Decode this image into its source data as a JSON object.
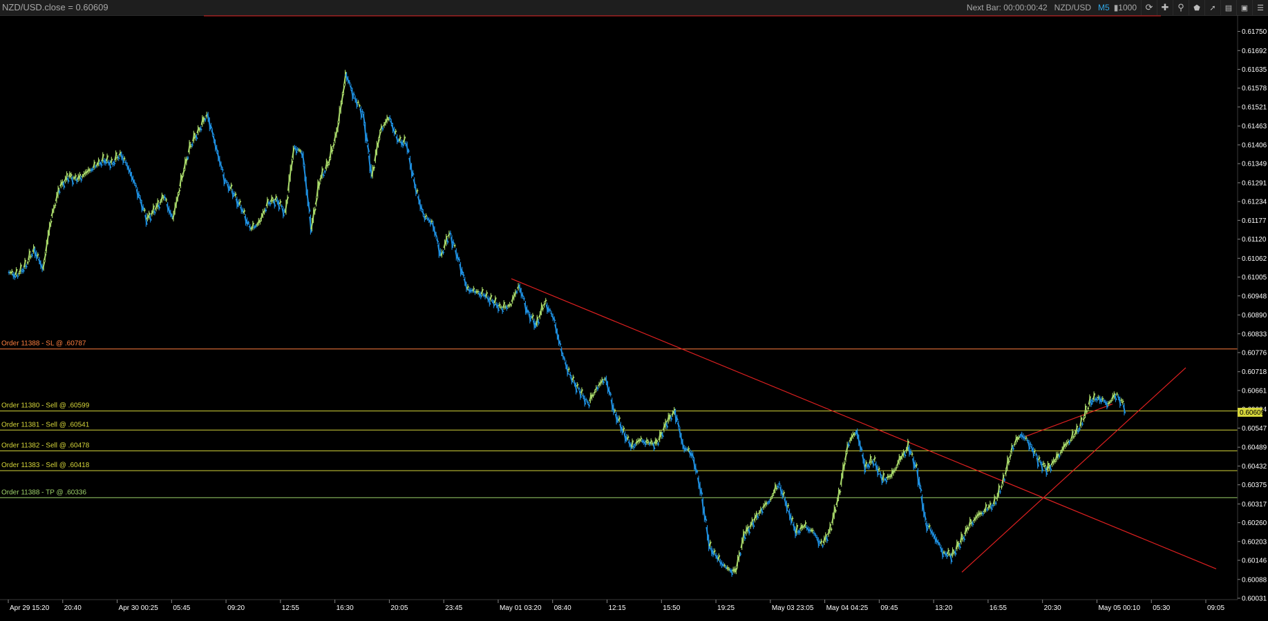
{
  "window": {
    "title": "NZD/USD.close = 0.60609",
    "next_bar_label": "Next Bar: 00:00:00:42",
    "symbol": "NZD/USD",
    "timeframe": "M5",
    "bar_count": "1000"
  },
  "toolbar_icons": [
    "refresh-icon",
    "crosshair-icon",
    "zoom-icon",
    "shape-icon",
    "line-tool-icon",
    "lock-icon",
    "save-icon",
    "menu-icon"
  ],
  "colors": {
    "background": "#000000",
    "up_candle": "#a8d86a",
    "down_candle": "#1e8fe0",
    "trendline": "#e02020",
    "sell_order": "#d6d63a",
    "stop_loss": "#ff7f3f",
    "take_profit": "#9ed36a"
  },
  "chart_data": {
    "type": "line",
    "symbol": "NZD/USD",
    "timeframe": "M5",
    "ylim": [
      0.60031,
      0.6177
    ],
    "y_ticks": [
      "0.61750",
      "0.61692",
      "0.61635",
      "0.61578",
      "0.61521",
      "0.61463",
      "0.61406",
      "0.61349",
      "0.61291",
      "0.61234",
      "0.61177",
      "0.61120",
      "0.61062",
      "0.61005",
      "0.60948",
      "0.60890",
      "0.60833",
      "0.60776",
      "0.60718",
      "0.60661",
      "0.60604",
      "0.60547",
      "0.60489",
      "0.60432",
      "0.60375",
      "0.60317",
      "0.60260",
      "0.60203",
      "0.60146",
      "0.60088",
      "0.60031"
    ],
    "x_ticks": [
      "Apr 29 15:20",
      "20:40",
      "Apr 30 00:25",
      "05:45",
      "09:20",
      "12:55",
      "16:30",
      "20:05",
      "23:45",
      "May 01 03:20",
      "08:40",
      "12:15",
      "15:50",
      "19:25",
      "May 03 23:05",
      "May 04 04:25",
      "09:45",
      "13:20",
      "16:55",
      "20:30",
      "May 05 00:10",
      "05:30",
      "09:05"
    ],
    "current_price_label": "0.60609",
    "price_series": [
      [
        0,
        0.6102
      ],
      [
        2,
        0.6101
      ],
      [
        4,
        0.6104
      ],
      [
        6,
        0.6109
      ],
      [
        8,
        0.6103
      ],
      [
        10,
        0.6119
      ],
      [
        12,
        0.6128
      ],
      [
        14,
        0.6131
      ],
      [
        16,
        0.613
      ],
      [
        18,
        0.6132
      ],
      [
        20,
        0.6134
      ],
      [
        22,
        0.6136
      ],
      [
        24,
        0.6135
      ],
      [
        26,
        0.6138
      ],
      [
        28,
        0.6133
      ],
      [
        30,
        0.6126
      ],
      [
        32,
        0.6118
      ],
      [
        34,
        0.6121
      ],
      [
        36,
        0.6125
      ],
      [
        38,
        0.6118
      ],
      [
        40,
        0.613
      ],
      [
        42,
        0.614
      ],
      [
        44,
        0.6145
      ],
      [
        46,
        0.615
      ],
      [
        48,
        0.614
      ],
      [
        50,
        0.613
      ],
      [
        52,
        0.6126
      ],
      [
        54,
        0.6121
      ],
      [
        56,
        0.6115
      ],
      [
        58,
        0.6117
      ],
      [
        60,
        0.6123
      ],
      [
        62,
        0.6124
      ],
      [
        64,
        0.612
      ],
      [
        66,
        0.614
      ],
      [
        68,
        0.6138
      ],
      [
        70,
        0.6115
      ],
      [
        72,
        0.613
      ],
      [
        74,
        0.6135
      ],
      [
        76,
        0.6145
      ],
      [
        78,
        0.6162
      ],
      [
        80,
        0.6155
      ],
      [
        82,
        0.615
      ],
      [
        84,
        0.6131
      ],
      [
        86,
        0.6145
      ],
      [
        88,
        0.6149
      ],
      [
        90,
        0.6142
      ],
      [
        92,
        0.6141
      ],
      [
        94,
        0.6128
      ],
      [
        96,
        0.6119
      ],
      [
        98,
        0.6117
      ],
      [
        100,
        0.6107
      ],
      [
        102,
        0.6114
      ],
      [
        104,
        0.6106
      ],
      [
        106,
        0.6097
      ],
      [
        108,
        0.6096
      ],
      [
        110,
        0.6095
      ],
      [
        112,
        0.6093
      ],
      [
        114,
        0.6091
      ],
      [
        116,
        0.6092
      ],
      [
        118,
        0.6098
      ],
      [
        120,
        0.609
      ],
      [
        122,
        0.6086
      ],
      [
        124,
        0.6093
      ],
      [
        126,
        0.6088
      ],
      [
        128,
        0.6077
      ],
      [
        130,
        0.607
      ],
      [
        132,
        0.6066
      ],
      [
        134,
        0.6062
      ],
      [
        136,
        0.6067
      ],
      [
        138,
        0.607
      ],
      [
        140,
        0.606
      ],
      [
        142,
        0.6054
      ],
      [
        144,
        0.6049
      ],
      [
        146,
        0.6051
      ],
      [
        148,
        0.605
      ],
      [
        150,
        0.605
      ],
      [
        152,
        0.6056
      ],
      [
        154,
        0.606
      ],
      [
        156,
        0.6049
      ],
      [
        158,
        0.6047
      ],
      [
        160,
        0.6036
      ],
      [
        162,
        0.6019
      ],
      [
        164,
        0.6015
      ],
      [
        166,
        0.6012
      ],
      [
        168,
        0.6011
      ],
      [
        170,
        0.6022
      ],
      [
        172,
        0.6026
      ],
      [
        174,
        0.603
      ],
      [
        176,
        0.6033
      ],
      [
        178,
        0.6038
      ],
      [
        180,
        0.6031
      ],
      [
        182,
        0.6023
      ],
      [
        184,
        0.6025
      ],
      [
        186,
        0.6023
      ],
      [
        188,
        0.6019
      ],
      [
        190,
        0.6024
      ],
      [
        192,
        0.6035
      ],
      [
        194,
        0.605
      ],
      [
        196,
        0.6054
      ],
      [
        198,
        0.6043
      ],
      [
        200,
        0.6045
      ],
      [
        202,
        0.6039
      ],
      [
        204,
        0.604
      ],
      [
        206,
        0.6045
      ],
      [
        208,
        0.6049
      ],
      [
        210,
        0.6042
      ],
      [
        212,
        0.6026
      ],
      [
        214,
        0.6022
      ],
      [
        216,
        0.6017
      ],
      [
        218,
        0.6016
      ],
      [
        220,
        0.602
      ],
      [
        222,
        0.6025
      ],
      [
        224,
        0.6028
      ],
      [
        226,
        0.603
      ],
      [
        228,
        0.6032
      ],
      [
        230,
        0.6039
      ],
      [
        232,
        0.6049
      ],
      [
        234,
        0.6053
      ],
      [
        236,
        0.605
      ],
      [
        238,
        0.6045
      ],
      [
        240,
        0.6042
      ],
      [
        242,
        0.6045
      ],
      [
        244,
        0.6049
      ],
      [
        246,
        0.6052
      ],
      [
        248,
        0.6056
      ],
      [
        250,
        0.6063
      ],
      [
        252,
        0.6064
      ],
      [
        254,
        0.6062
      ],
      [
        256,
        0.6065
      ],
      [
        258,
        0.6061
      ]
    ],
    "order_lines": [
      {
        "label": "Order 11388 - SL @ .60787",
        "price": 0.60787,
        "kind": "sl"
      },
      {
        "label": "Order 11380 - Sell @ .60599",
        "price": 0.60599,
        "kind": "sell"
      },
      {
        "label": "Order 11381 - Sell @ .60541",
        "price": 0.60541,
        "kind": "sell"
      },
      {
        "label": "Order 11382 - Sell @ .60478",
        "price": 0.60478,
        "kind": "sell"
      },
      {
        "label": "Order 11383 - Sell @ .60418",
        "price": 0.60418,
        "kind": "sell"
      },
      {
        "label": "Order 11388 - TP @ .60336",
        "price": 0.60336,
        "kind": "tp"
      }
    ],
    "grid": false,
    "legend": "none"
  }
}
